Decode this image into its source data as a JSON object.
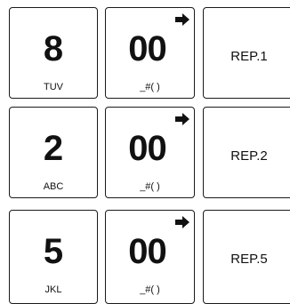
{
  "rows": [
    {
      "digit": {
        "label": "8",
        "letters": "TUV"
      },
      "zero": {
        "label": "00",
        "symbols": "_#( )"
      },
      "rep": {
        "label": "REP.1"
      }
    },
    {
      "digit": {
        "label": "2",
        "letters": "ABC"
      },
      "zero": {
        "label": "00",
        "symbols": "_#( )"
      },
      "rep": {
        "label": "REP.2"
      }
    },
    {
      "digit": {
        "label": "5",
        "letters": "JKL"
      },
      "zero": {
        "label": "00",
        "symbols": "_#( )"
      },
      "rep": {
        "label": "REP.5"
      }
    }
  ],
  "icons": {
    "zero_key_arrow": "right-arrow-icon"
  }
}
